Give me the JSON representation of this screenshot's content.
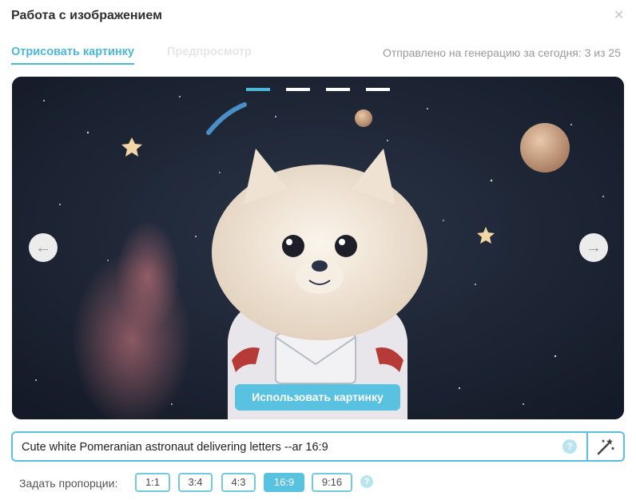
{
  "dialog": {
    "title": "Работа с изображением",
    "close_icon": "close-icon"
  },
  "tabs": [
    {
      "label": "Отрисовать картинку"
    },
    {
      "label": "Предпросмотр"
    }
  ],
  "counter_text": "Отправлено на генерацию за сегодня: 3 из 25",
  "carousel": {
    "slides_total": 4,
    "active_slide": 1,
    "prev_icon": "arrow-left-icon",
    "next_icon": "arrow-right-icon",
    "use_button": "Использовать картинку",
    "accent_color": "#58c2e0"
  },
  "prompt": {
    "value": "Cute white Pomeranian astronaut delivering letters --ar 16:9",
    "help_icon": "?",
    "magic_icon": "magic-wand-icon"
  },
  "ratios": {
    "label": "Задать пропорции:",
    "options": [
      "1:1",
      "3:4",
      "4:3",
      "16:9",
      "9:16"
    ],
    "selected": "16:9",
    "help_icon": "?"
  }
}
